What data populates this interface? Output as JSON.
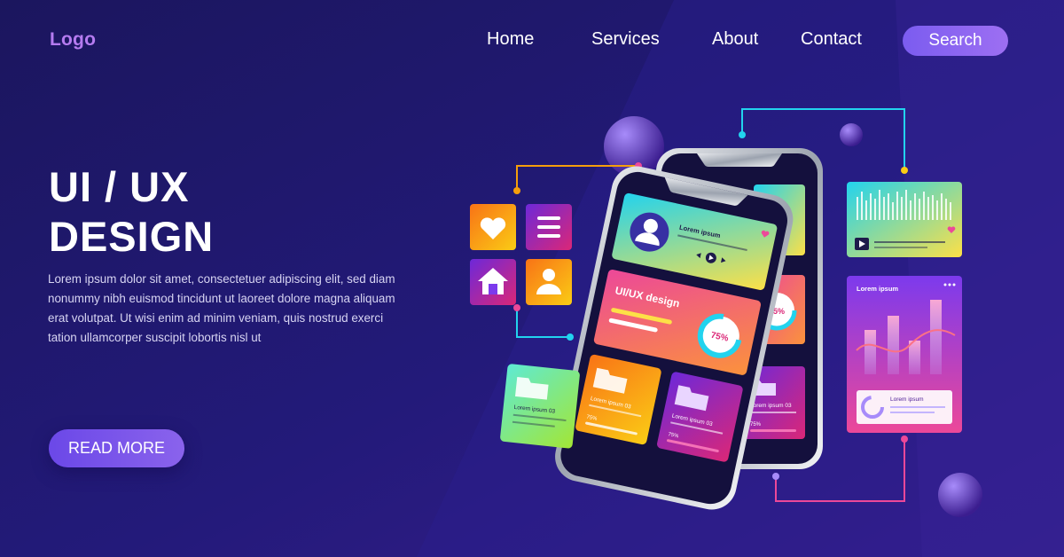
{
  "nav": {
    "logo": "Logo",
    "links": [
      "Home",
      "Services",
      "About",
      "Contact"
    ],
    "search_label": "Search"
  },
  "hero": {
    "title_line1": "UI / UX",
    "title_line2": "DESIGN",
    "body_lines": [
      "Lorem ipsum dolor sit amet, consectetuer adipiscing elit, sed diam",
      "nonummy nibh euismod tincidunt ut laoreet dolore magna aliquam",
      "erat volutpat. Ut wisi enim ad minim veniam, quis nostrud exerci",
      "tation ullamcorper suscipit lobortis nisl ut"
    ],
    "cta_label": "READ MORE"
  },
  "illustration": {
    "profile_card_title": "Lorem ipsum",
    "design_card_title": "UI/UX design",
    "design_card_percent": "75%",
    "back_phone_percent": "75%",
    "back_folder_label": "Lorem ipsum 03",
    "back_folder_percent": "75%",
    "folder_card_1_label": "Lorem ipsum 03",
    "folder_card_1_percent": "75%",
    "folder_card_2_label": "Lorem ipsum 03",
    "folder_card_2_percent": "75%",
    "left_folder_label": "Lorem ipsum 03",
    "stats_card_title": "Lorem ipsum",
    "stats_card_caption": "Lorem ipsum"
  },
  "colors": {
    "background": "#1a1560",
    "logo": "#b57bf0",
    "accent": "#7b5cf0"
  }
}
